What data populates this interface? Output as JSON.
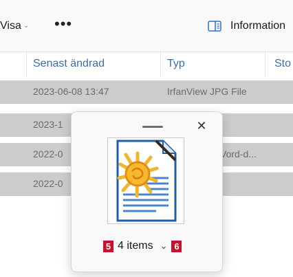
{
  "toolbar": {
    "view_label": "Visa",
    "more_label": "•••",
    "info_label": "Information"
  },
  "columns": [
    {
      "label": "Senast ändrad"
    },
    {
      "label": "Typ"
    },
    {
      "label": "Sto"
    }
  ],
  "rows": [
    {
      "modified": "2023-06-08 13:47",
      "type": "IrfanView JPG File"
    },
    {
      "modified": "2023-1",
      "type": ""
    },
    {
      "modified": "2022-0",
      "type": "Vord-d..."
    },
    {
      "modified": "2022-0",
      "type": ""
    }
  ],
  "popup": {
    "close_glyph": "✕",
    "items_label": "4 items",
    "chevron": "⌄",
    "badge_left": "5",
    "badge_right": "6",
    "thumb_icon": "libreoffice-writer-document-icon"
  },
  "colors": {
    "row_selected": "#cccccc",
    "badge": "#c8102e",
    "header_text": "#3b6fa8"
  }
}
